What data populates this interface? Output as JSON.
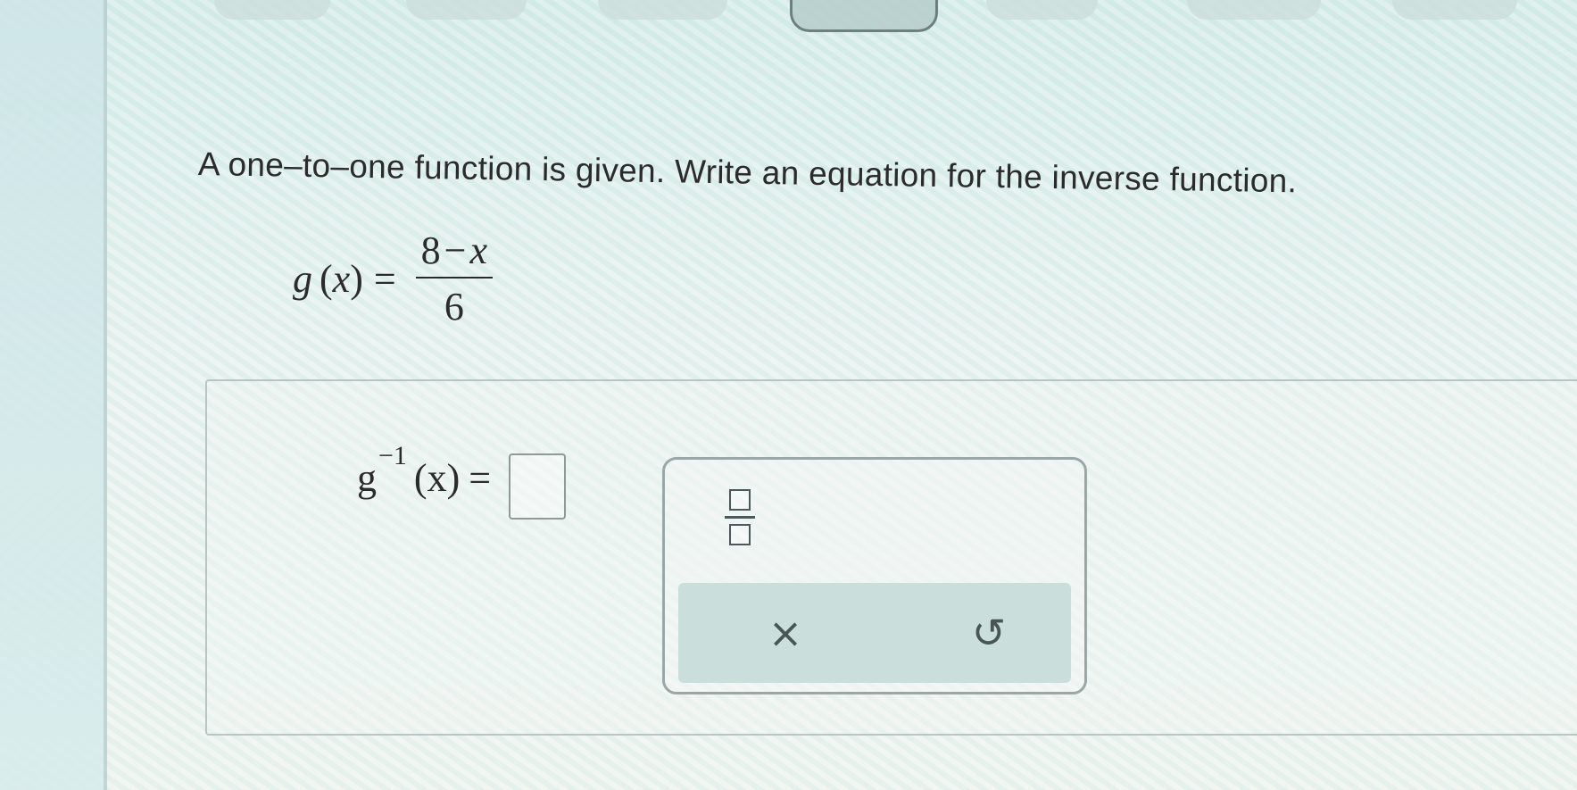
{
  "nav": {
    "pills": [
      {
        "id": "nav-pill-1"
      },
      {
        "id": "nav-pill-2"
      },
      {
        "id": "nav-pill-3"
      },
      {
        "id": "nav-pill-4",
        "active": true
      },
      {
        "id": "nav-pill-5"
      },
      {
        "id": "nav-pill-6"
      },
      {
        "id": "nav-pill-7"
      }
    ]
  },
  "question": {
    "prompt": "A one–to–one function is given. Write an equation for the inverse function."
  },
  "given": {
    "func": "g",
    "lparen": "(",
    "var": "x",
    "rparen": ")",
    "equals": "=",
    "numerator_num": "8",
    "numerator_minus": "−",
    "numerator_var": "x",
    "denominator": "6"
  },
  "answer": {
    "func": "g",
    "superscript": "−1",
    "lparen": "(",
    "var": "x",
    "rparen": ")",
    "equals": "="
  },
  "tools": {
    "fraction_icon": "fraction-icon",
    "clear_icon": "×",
    "undo_icon": "↺"
  },
  "colors": {
    "text": "#2b2b2b",
    "panel_border": "#9aa7a7",
    "action_bar": "#c3dad6"
  }
}
